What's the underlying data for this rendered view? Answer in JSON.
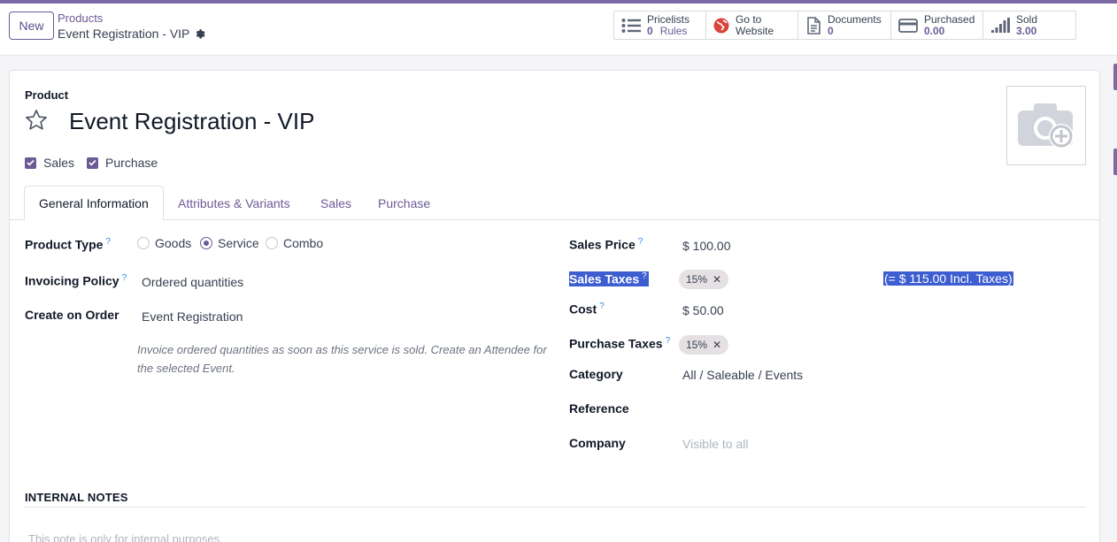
{
  "control_panel": {
    "new_label": "New",
    "breadcrumb_parent": "Products",
    "breadcrumb_current": "Event Registration - VIP",
    "smart_buttons": [
      {
        "line1": "Pricelists",
        "value": "0",
        "unit": "Rules",
        "icon": "list-icon"
      },
      {
        "line1": "Go to",
        "line2": "Website",
        "icon": "globe-icon"
      },
      {
        "line1": "Documents",
        "value": "0",
        "icon": "document-icon"
      },
      {
        "line1": "Purchased",
        "value": "0.00",
        "icon": "credit-card-icon"
      },
      {
        "line1": "Sold",
        "value": "3.00",
        "icon": "signal-bars-icon"
      }
    ]
  },
  "form": {
    "type_label": "Product",
    "title": "Event Registration - VIP",
    "checkboxes": [
      {
        "label": "Sales",
        "checked": true
      },
      {
        "label": "Purchase",
        "checked": true
      }
    ],
    "tabs": [
      "General Information",
      "Attributes & Variants",
      "Sales",
      "Purchase"
    ],
    "active_tab": "General Information",
    "left": {
      "product_type_label": "Product Type",
      "product_type_options": [
        "Goods",
        "Service",
        "Combo"
      ],
      "product_type_selected": "Service",
      "invoicing_policy_label": "Invoicing Policy",
      "invoicing_policy_value": "Ordered quantities",
      "create_on_order_label": "Create on Order",
      "create_on_order_value": "Event Registration",
      "help_text": "Invoice ordered quantities as soon as this service is sold. Create an Attendee for the selected Event."
    },
    "right": {
      "sales_price_label": "Sales Price",
      "sales_price_value": "$ 100.00",
      "sales_taxes_label": "Sales Taxes",
      "sales_taxes_tag": "15%",
      "sales_taxes_incl": "(= $ 115.00 Incl. Taxes)",
      "cost_label": "Cost",
      "cost_value": "$ 50.00",
      "purchase_taxes_label": "Purchase Taxes",
      "purchase_taxes_tag": "15%",
      "category_label": "Category",
      "category_value": "All / Saleable / Events",
      "reference_label": "Reference",
      "reference_value": "",
      "company_label": "Company",
      "company_placeholder": "Visible to all"
    },
    "internal_notes_heading": "INTERNAL NOTES",
    "internal_notes_placeholder": "This note is only for internal purposes."
  },
  "colors": {
    "accent": "#6b5b95",
    "top_bar": "#7c6aa6",
    "help_link": "#2e86de",
    "selection": "#3d5ed1"
  }
}
